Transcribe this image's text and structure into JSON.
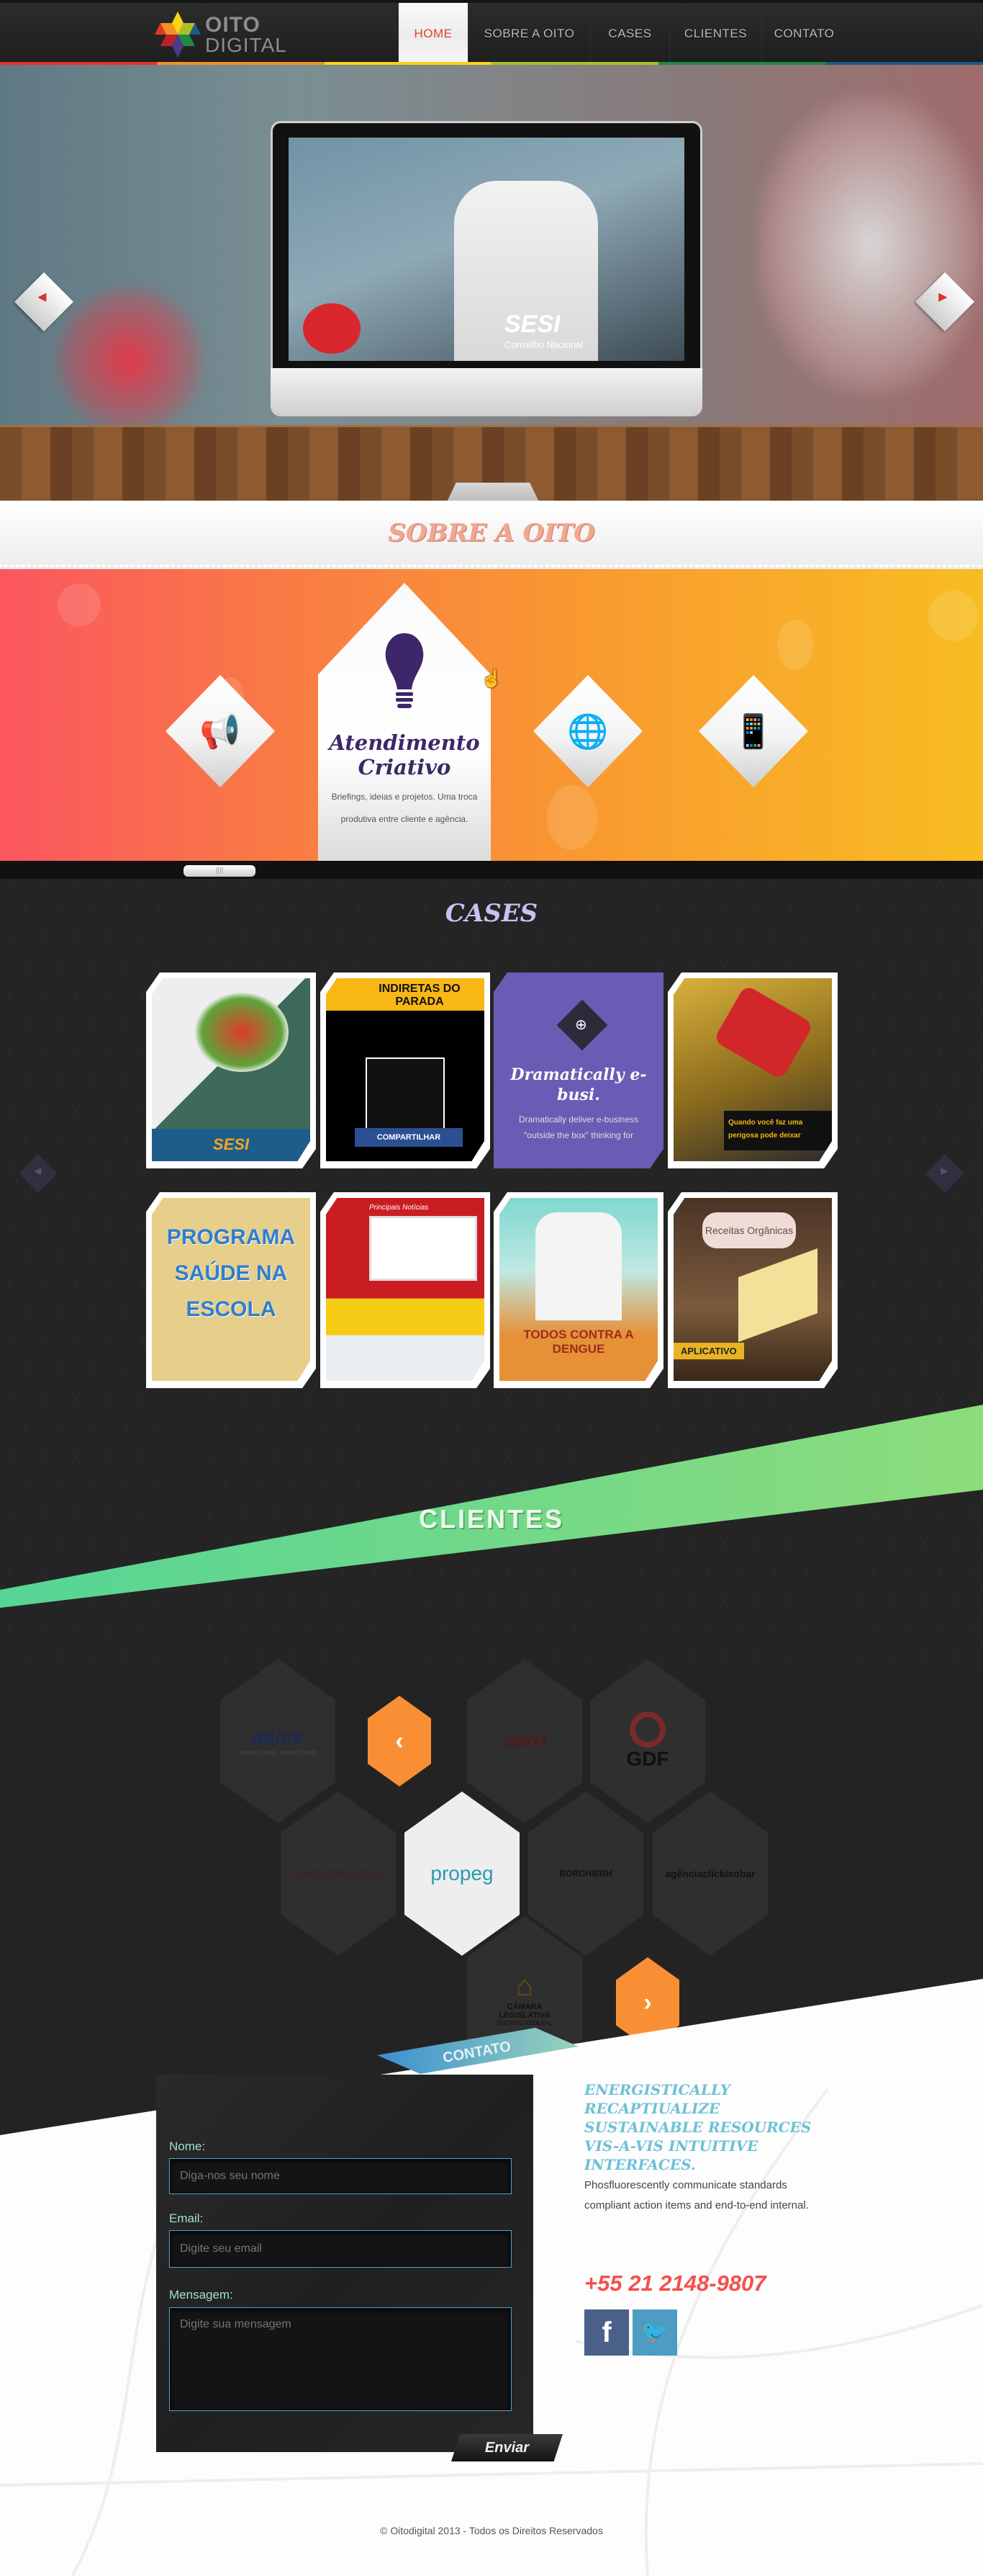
{
  "nav": {
    "logo_line1": "OITO",
    "logo_line2": "DIGITAL",
    "items": [
      {
        "label": "HOME",
        "active": true
      },
      {
        "label": "SOBRE A OITO"
      },
      {
        "label": "CASES"
      },
      {
        "label": "CLIENTES"
      },
      {
        "label": "CONTATO"
      }
    ]
  },
  "hero": {
    "screen_logo": "SESI",
    "screen_logo_sub": "Conselho Nacional",
    "prev_icon": "arrow-left-icon",
    "next_icon": "arrow-right-icon"
  },
  "sobre": {
    "title": "SOBRE A OITO",
    "featured": {
      "title": "Atendimento Criativo",
      "description": "Briefings, ideias e projetos. Uma troca produtiva entre cliente e agência.",
      "icon": "lightbulb-icon"
    },
    "other_icons": [
      "megaphone-icon",
      "globe-icon",
      "mobile-phone-icon"
    ]
  },
  "cases": {
    "title": "CASES",
    "items": [
      {
        "caption": "SESI"
      },
      {
        "caption": "INDIRETAS DO PARADA",
        "button": "COMPARTILHAR"
      },
      {
        "title": "Dramatically e-busi.",
        "description": "Dramatically deliver e-business \"outside the box\" thinking for",
        "icon": "zoom-in-icon"
      },
      {
        "caption": "Quando você faz uma perigosa pode deixar"
      },
      {
        "caption": "PROGRAMA SAÚDE NA ESCOLA"
      },
      {
        "caption": "Principais Notícias"
      },
      {
        "caption": "TODOS CONTRA A DENGUE"
      },
      {
        "caption": "Receitas Orgânicas",
        "badge": "APLICATIVO"
      }
    ]
  },
  "clientes": {
    "title": "CLIENTES",
    "logos": [
      "asics",
      "caliaY2",
      "GDF",
      "AGNELOPACHECO",
      "propeg",
      "BORGHIERH",
      "agênciaclickisobar",
      "CÂMARA LEGISLATIVA"
    ],
    "asics_tagline": "sound mind, sound body",
    "camara_sub": "DISTRITO FEDERAL"
  },
  "contato": {
    "ribbon": "CONTATO",
    "form": {
      "name_label": "Nome:",
      "name_placeholder": "Diga-nos seu nome",
      "email_label": "Email:",
      "email_placeholder": "Digite seu email",
      "message_label": "Mensagem:",
      "message_placeholder": "Digite sua mensagem",
      "submit": "Enviar"
    },
    "heading": "ENERGISTICALLY RECAPTIUALIZE SUSTAINABLE RESOURCES VIS-A-VIS INTUITIVE INTERFACES.",
    "paragraph": "Phosfluorescently communicate standards compliant action items and end-to-end internal.",
    "phone": "+55 21 2148-9807",
    "social": [
      {
        "name": "facebook-icon",
        "glyph": "f",
        "color": "#4a6089"
      },
      {
        "name": "twitter-icon",
        "glyph": "t",
        "color": "#4d9cc2"
      }
    ]
  },
  "footer": {
    "copyright": "© Oitodigital 2013 - Todos os Direitos Reservados"
  }
}
